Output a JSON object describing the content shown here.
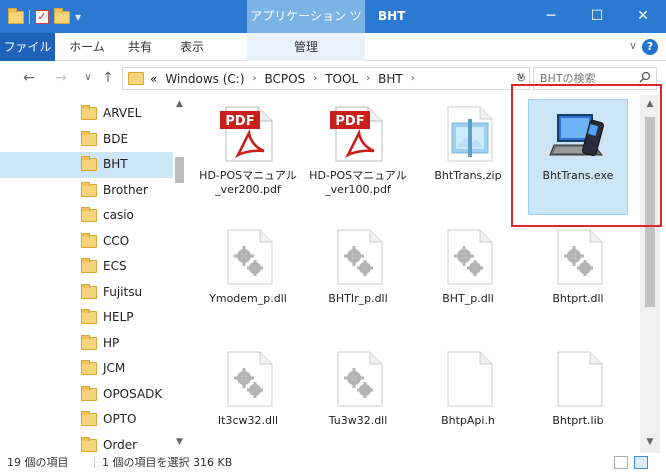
{
  "titlebar": {
    "context_tab": "アプリケーション ツール",
    "title": "BHT",
    "min": "─",
    "max": "☐",
    "close": "✕"
  },
  "ribbon": {
    "tabs": [
      "ファイル",
      "ホーム",
      "共有",
      "表示",
      "管理"
    ],
    "help": "?"
  },
  "address": {
    "crumbs": [
      "«",
      "Windows (C:)",
      "BCPOS",
      "TOOL",
      "BHT"
    ],
    "search_placeholder": "BHTの検索"
  },
  "sidebar": {
    "items": [
      "ARVEL",
      "BDE",
      "BHT",
      "Brother",
      "casio",
      "CCO",
      "ECS",
      "Fujitsu",
      "HELP",
      "HP",
      "JCM",
      "OPOSADK",
      "OPTO",
      "Order"
    ],
    "selected": "BHT"
  },
  "files": [
    {
      "name": "HD-POSマニュアル_ver200.pdf",
      "type": "pdf"
    },
    {
      "name": "HD-POSマニュアル_ver100.pdf",
      "type": "pdf"
    },
    {
      "name": "BhtTrans.zip",
      "type": "zip"
    },
    {
      "name": "BhtTrans.exe",
      "type": "exe",
      "selected": true
    },
    {
      "name": "Ymodem_p.dll",
      "type": "dll"
    },
    {
      "name": "BHTIr_p.dll",
      "type": "dll"
    },
    {
      "name": "BHT_p.dll",
      "type": "dll"
    },
    {
      "name": "Bhtprt.dll",
      "type": "dll"
    },
    {
      "name": "It3cw32.dll",
      "type": "dll"
    },
    {
      "name": "Tu3w32.dll",
      "type": "dll"
    },
    {
      "name": "BhtpApi.h",
      "type": "file"
    },
    {
      "name": "Bhtprt.lib",
      "type": "file"
    }
  ],
  "pdf_badge": "PDF",
  "status": {
    "count": "19 個の項目",
    "selection": "1 個の項目を選択 316 KB"
  },
  "colors": {
    "titlebar": "#2b79d0",
    "selection": "#cce5f7",
    "highlight_box": "#e0262a"
  }
}
